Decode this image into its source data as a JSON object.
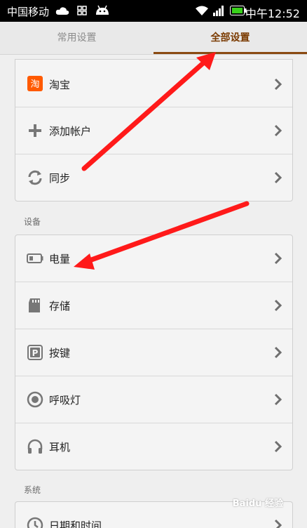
{
  "status_bar": {
    "carrier": "中国移动",
    "time": "中午12:52"
  },
  "tabs": [
    {
      "label": "常用设置",
      "selected": false
    },
    {
      "label": "全部设置",
      "selected": true
    }
  ],
  "accounts_group": {
    "items": [
      {
        "label": "淘宝",
        "icon": "taobao-icon"
      },
      {
        "label": "添加帐户",
        "icon": "plus-icon"
      },
      {
        "label": "同步",
        "icon": "sync-icon"
      }
    ]
  },
  "device_section": {
    "title": "设备",
    "items": [
      {
        "label": "电量",
        "icon": "battery-icon"
      },
      {
        "label": "存储",
        "icon": "sd-card-icon"
      },
      {
        "label": "按键",
        "icon": "key-icon"
      },
      {
        "label": "呼吸灯",
        "icon": "led-icon"
      },
      {
        "label": "耳机",
        "icon": "headphones-icon"
      }
    ]
  },
  "system_section": {
    "title": "系统",
    "items": [
      {
        "label": "日期和时间",
        "icon": "clock-icon"
      }
    ]
  },
  "colors": {
    "accent": "#7a3a00",
    "annotation_arrow": "#ff1a1a"
  },
  "watermark": "Baidu 经验"
}
